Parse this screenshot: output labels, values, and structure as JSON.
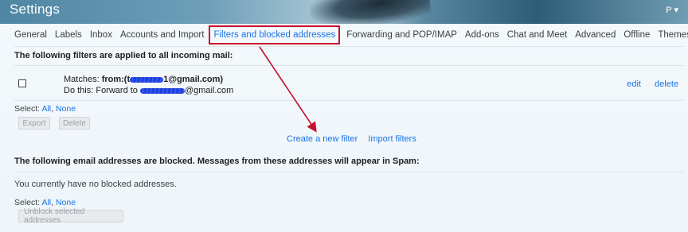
{
  "header": {
    "title": "Settings",
    "account_label": "P",
    "account_caret": "▾"
  },
  "tabs": [
    {
      "label": "General"
    },
    {
      "label": "Labels"
    },
    {
      "label": "Inbox"
    },
    {
      "label": "Accounts and Import"
    },
    {
      "label": "Filters and blocked addresses",
      "active": true
    },
    {
      "label": "Forwarding and POP/IMAP"
    },
    {
      "label": "Add-ons"
    },
    {
      "label": "Chat and Meet"
    },
    {
      "label": "Advanced"
    },
    {
      "label": "Offline"
    },
    {
      "label": "Themes"
    }
  ],
  "filters": {
    "heading": "The following filters are applied to all incoming mail:",
    "item": {
      "matches_label": "Matches:",
      "matches_prefix": "from:(t",
      "matches_suffix": "1@gmail.com)",
      "action_label": "Do this: Forward to",
      "action_suffix": "@gmail.com",
      "edit": "edit",
      "delete": "delete"
    },
    "select_label": "Select:",
    "select_all": "All",
    "select_sep": ", ",
    "select_none": "None",
    "export_button": "Export",
    "delete_button": "Delete",
    "create_link": "Create a new filter",
    "import_link": "Import filters"
  },
  "blocked": {
    "heading": "The following email addresses are blocked. Messages from these addresses will appear in Spam:",
    "empty_text": "You currently have no blocked addresses.",
    "select_label": "Select:",
    "select_all": "All",
    "select_sep": ", ",
    "select_none": "None",
    "unblock_button": "Unblock selected addresses"
  },
  "colors": {
    "link": "#1a73e8",
    "annotation": "#c8102e",
    "redaction": "#2b4fe8"
  }
}
